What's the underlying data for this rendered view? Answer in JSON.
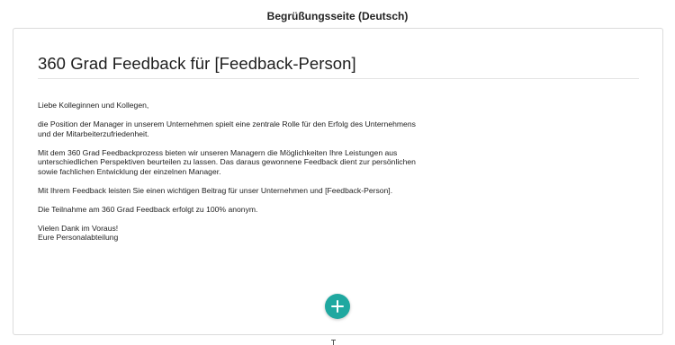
{
  "header": {
    "title": "Begrüßungsseite (Deutsch)"
  },
  "card": {
    "title": "360 Grad Feedback für [Feedback-Person]",
    "paragraphs": [
      [
        "Liebe Kolleginnen und Kollegen,"
      ],
      [
        "die Position der Manager in unserem Unternehmen spielt eine zentrale Rolle für den Erfolg des Unternehmens",
        "und der Mitarbeiterzufriedenheit."
      ],
      [
        "Mit dem 360 Grad Feedbackprozess bieten wir unseren Managern die Möglichkeiten Ihre Leistungen aus",
        "unterschiedlichen Perspektiven beurteilen zu lassen. Das daraus gewonnene Feedback dient zur persönlichen",
        "sowie fachlichen Entwicklung der einzelnen Manager."
      ],
      [
        "Mit Ihrem Feedback leisten Sie einen wichtigen Beitrag für unser Unternehmen und [Feedback-Person]."
      ],
      [
        "Die Teilnahme am 360 Grad Feedback erfolgt zu 100% anonym."
      ],
      [
        "Vielen Dank im Voraus!",
        "Eure Personalabteilung"
      ]
    ]
  },
  "actions": {
    "add_icon": "plus-icon",
    "accent_color": "#1fa8a0"
  }
}
